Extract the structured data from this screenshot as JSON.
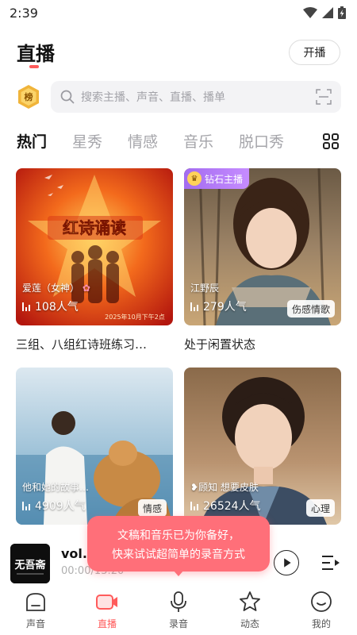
{
  "status_bar": {
    "time": "2:39"
  },
  "header": {
    "title": "直播",
    "go_live_label": "开播"
  },
  "rank_badge": {
    "text": "榜"
  },
  "search": {
    "placeholder": "搜索主播、声音、直播、播单"
  },
  "tabs": [
    "热门",
    "星秀",
    "情感",
    "音乐",
    "脱口秀"
  ],
  "cards": [
    {
      "art_text": "红诗诵读",
      "name": "爱莲（女神）",
      "popularity": "108人气",
      "caption": "三组、八组红诗班练习…",
      "date_text": "2025年10月下午2点"
    },
    {
      "badge": "钻石主播",
      "name": "江野辰",
      "popularity": "279人气",
      "tag": "伤感情歌",
      "caption": "处于闲置状态"
    },
    {
      "name": "他和她的故事…",
      "popularity": "4909人气",
      "tag": "情感"
    },
    {
      "name": "顾知 想要皮肤",
      "popularity": "26524人气",
      "tag": "心理"
    }
  ],
  "player": {
    "title": "vol.5",
    "time": "00:00/13:20",
    "cover_text": "无吾斋"
  },
  "tooltip": {
    "line1": "文稿和音乐已为你备好，",
    "line2": "快来试试超简单的录音方式"
  },
  "nav": [
    {
      "label": "声音",
      "icon": "home-icon"
    },
    {
      "label": "直播",
      "icon": "live-camera-icon"
    },
    {
      "label": "录音",
      "icon": "microphone-icon"
    },
    {
      "label": "动态",
      "icon": "star-icon"
    },
    {
      "label": "我的",
      "icon": "profile-icon"
    }
  ],
  "colors": {
    "accent": "#ff5b5b",
    "tooltip": "#ff6f79",
    "badge_purple": "#a36cf0",
    "search_bg": "#f3f3f5"
  }
}
